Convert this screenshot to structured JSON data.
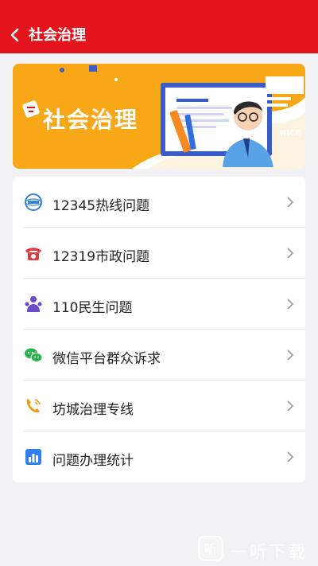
{
  "header": {
    "title": "社会治理"
  },
  "banner": {
    "title": "社会治理",
    "badge": "NICE"
  },
  "menu": [
    {
      "label": "12345热线问题",
      "icon": "hotline-12345-icon"
    },
    {
      "label": "12319市政问题",
      "icon": "red-phone-icon"
    },
    {
      "label": "110民生问题",
      "icon": "people-icon"
    },
    {
      "label": "微信平台群众诉求",
      "icon": "wechat-icon"
    },
    {
      "label": "坊城治理专线",
      "icon": "phone-call-icon"
    },
    {
      "label": "问题办理统计",
      "icon": "bar-chart-icon"
    }
  ],
  "watermark": {
    "text": "一听下载"
  },
  "colors": {
    "accent": "#e3141b",
    "banner": "#f8a716"
  }
}
